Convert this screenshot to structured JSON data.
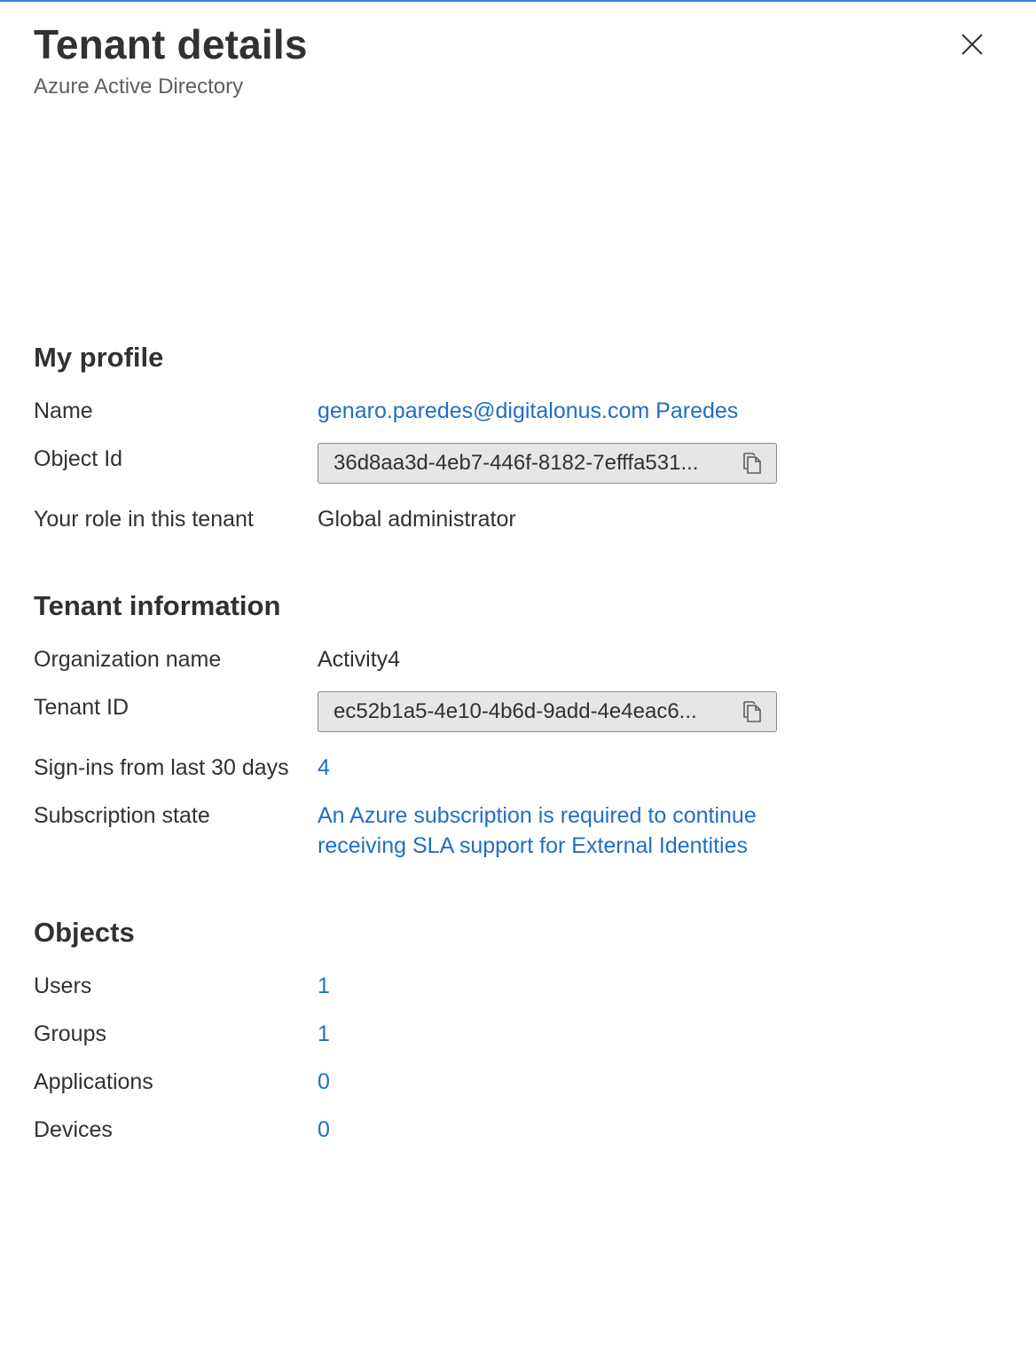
{
  "panel": {
    "title": "Tenant details",
    "subtitle": "Azure Active Directory",
    "close_icon": "close-icon"
  },
  "my_profile": {
    "heading": "My profile",
    "name_label": "Name",
    "name_value": "genaro.paredes@digitalonus.com Paredes",
    "object_id_label": "Object Id",
    "object_id_value": "36d8aa3d-4eb7-446f-8182-7efffa531...",
    "role_label": "Your role in this tenant",
    "role_value": "Global administrator"
  },
  "tenant_information": {
    "heading": "Tenant information",
    "org_label": "Organization name",
    "org_value": "Activity4",
    "tenant_id_label": "Tenant ID",
    "tenant_id_value": "ec52b1a5-4e10-4b6d-9add-4e4eac6...",
    "signins_label": "Sign-ins from last 30 days",
    "signins_value": "4",
    "subscription_label": "Subscription state",
    "subscription_value": "An Azure subscription is required to continue receiving SLA support for External Identities"
  },
  "objects": {
    "heading": "Objects",
    "users_label": "Users",
    "users_value": "1",
    "groups_label": "Groups",
    "groups_value": "1",
    "applications_label": "Applications",
    "applications_value": "0",
    "devices_label": "Devices",
    "devices_value": "0"
  },
  "colors": {
    "accent_border": "#3b7fd4",
    "link": "#1f6fc5",
    "text": "#323130",
    "subtle_text": "#605e5c",
    "field_background": "#e6e6e6"
  },
  "icons": {
    "copy": "copy-icon",
    "close": "close-icon"
  }
}
